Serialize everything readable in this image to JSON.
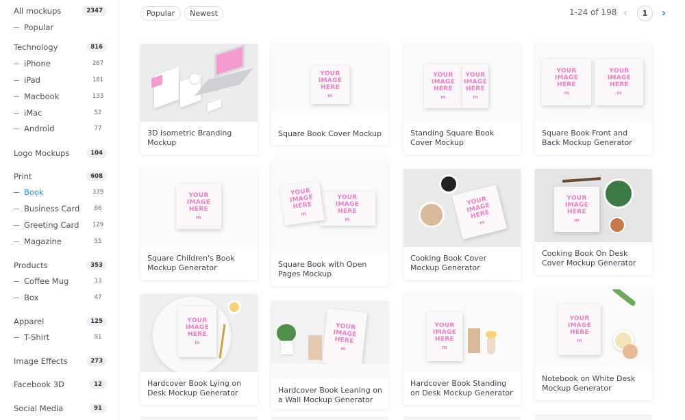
{
  "sidebar": {
    "categories": [
      {
        "label": "All mockups",
        "count": "2347"
      },
      {
        "label": "Technology",
        "count": "816"
      },
      {
        "label": "Logo Mockups",
        "count": "104"
      },
      {
        "label": "Print",
        "count": "608"
      },
      {
        "label": "Products",
        "count": "353"
      },
      {
        "label": "Apparel",
        "count": "125"
      },
      {
        "label": "Image Effects",
        "count": "273"
      },
      {
        "label": "Facebook 3D",
        "count": "12"
      },
      {
        "label": "Social Media",
        "count": "91"
      }
    ],
    "subitems": [
      {
        "label": "Popular",
        "count": ""
      },
      {
        "label": "iPhone",
        "count": "267"
      },
      {
        "label": "iPad",
        "count": "181"
      },
      {
        "label": "Macbook",
        "count": "133"
      },
      {
        "label": "iMac",
        "count": "52"
      },
      {
        "label": "Android",
        "count": "77"
      },
      {
        "label": "Book",
        "count": "339"
      },
      {
        "label": "Business Card",
        "count": "66"
      },
      {
        "label": "Greeting Card",
        "count": "129"
      },
      {
        "label": "Magazine",
        "count": "55"
      },
      {
        "label": "Coffee Mug",
        "count": "13"
      },
      {
        "label": "Box",
        "count": "47"
      },
      {
        "label": "T-Shirt",
        "count": "91"
      }
    ]
  },
  "toolbar": {
    "sort_popular": "Popular",
    "sort_newest": "Newest",
    "range": "1-24 of 198",
    "page": "1",
    "prev_icon": "‹",
    "next_icon": "›"
  },
  "mock_text": {
    "line1": "YOUR",
    "line2": "IMAGE",
    "line3": "HERE",
    "mark": "m"
  },
  "cards": [
    {
      "title": "3D Isometric Branding Mockup"
    },
    {
      "title": "Square Book Cover Mockup"
    },
    {
      "title": "Standing Square Book Cover Mockup"
    },
    {
      "title": "Square Book Front and Back Mockup Generator"
    },
    {
      "title": "Square Children's Book Mockup Generator"
    },
    {
      "title": "Square Book with Open Pages Mockup"
    },
    {
      "title": "Cooking Book Cover Mockup Generator"
    },
    {
      "title": "Cooking Book On Desk Cover Mockup Generator"
    },
    {
      "title": "Hardcover Book Lying on Desk Mockup Generator"
    },
    {
      "title": "Hardcover Book Leaning on a Wall Mockup Generator"
    },
    {
      "title": "Hardcover Book Standing on Desk Mockup Generator"
    },
    {
      "title": "Notebook on White Desk Mockup Generator"
    }
  ],
  "colors": {
    "accent": "#2a8ae6",
    "mock_pink": "#ef7fc5"
  }
}
